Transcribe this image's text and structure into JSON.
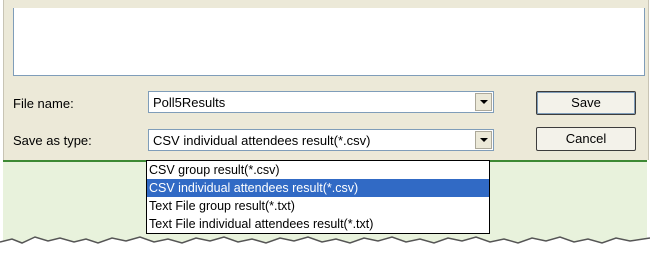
{
  "dialog": {
    "file_name_label": "File name:",
    "file_name_value": "Poll5Results",
    "save_as_type_label": "Save as type:",
    "save_as_type_value": "CSV individual attendees result(*.csv)",
    "save_label": "Save",
    "cancel_label": "Cancel"
  },
  "type_dropdown": {
    "options": [
      "CSV group result(*.csv)",
      "CSV individual attendees result(*.csv)",
      "Text File group result(*.txt)",
      "Text File individual attendees result(*.txt)"
    ],
    "selected_index": 1
  },
  "colors": {
    "selection": "#316ac5",
    "dialog_bg": "#ece9d8",
    "accent_green": "#3d8a34"
  }
}
